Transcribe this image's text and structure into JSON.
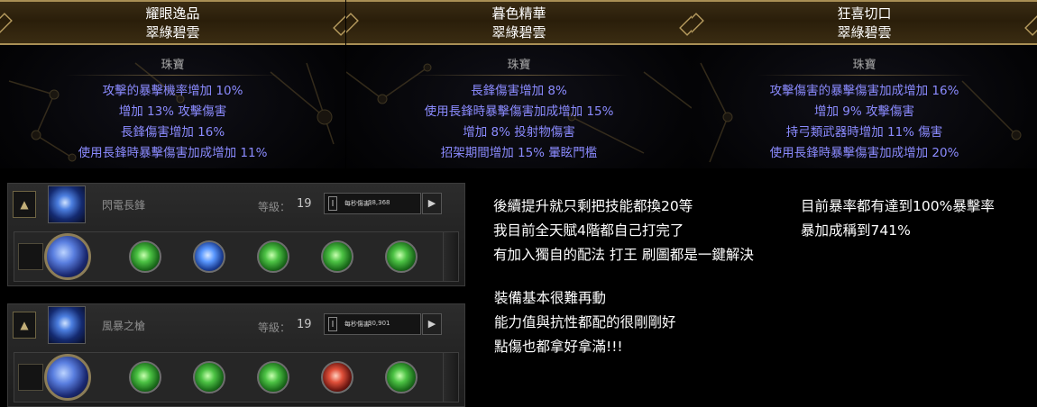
{
  "jewels": [
    {
      "name": "耀眼逸品",
      "base": "翠綠碧雲",
      "type": "珠寶",
      "mods": [
        "攻擊的暴擊機率增加 10%",
        "增加 13% 攻擊傷害",
        "長鋒傷害增加 16%",
        "使用長鋒時暴擊傷害加成增加 11%"
      ]
    },
    {
      "name": "暮色精華",
      "base": "翠綠碧雲",
      "type": "珠寶",
      "mods": [
        "長鋒傷害增加 8%",
        "使用長鋒時暴擊傷害加成增加 15%",
        "增加 8% 投射物傷害",
        "招架期間增加 15% 暈眩門檻"
      ]
    },
    {
      "name": "狂喜切口",
      "base": "翠綠碧雲",
      "type": "珠寶",
      "mods": [
        "攻擊傷害的暴擊傷害加成增加 16%",
        "增加 9% 攻擊傷害",
        "持弓類武器時增加 11% 傷害",
        "使用長鋒時暴擊傷害加成增加 20%"
      ]
    }
  ],
  "skills": [
    {
      "name": "閃電長鋒",
      "level_label": "等級：",
      "level": "19",
      "dps_label": "每秒傷害:",
      "dps": "38,368",
      "lock_icon": "lock-icon",
      "bar_glyph": "I",
      "arrow_glyph": "▶",
      "support_gems": [
        "green",
        "blue",
        "green",
        "green",
        "green"
      ]
    },
    {
      "name": "風暴之槍",
      "level_label": "等級：",
      "level": "19",
      "dps_label": "每秒傷害:",
      "dps": "30,901",
      "lock_icon": "lock-icon",
      "bar_glyph": "I",
      "arrow_glyph": "▶",
      "support_gems": [
        "green",
        "green",
        "green",
        "red",
        "green"
      ]
    }
  ],
  "notes": {
    "block1": [
      "後續提升就只剩把技能都換20等",
      "我目前全天賦4階都自己打完了",
      "有加入獨自的配法 打王 刷圖都是一鍵解決"
    ],
    "block2": [
      "裝備基本很難再動",
      "能力值與抗性都配的很剛剛好",
      "點傷也都拿好拿滿!!!"
    ],
    "block3": [
      "目前暴率都有達到100%暴擊率",
      "暴加成稱到741%"
    ]
  },
  "colors": {
    "mod_text": "#8b8bff",
    "header_gold": "#a98f55",
    "background": "#000000"
  }
}
